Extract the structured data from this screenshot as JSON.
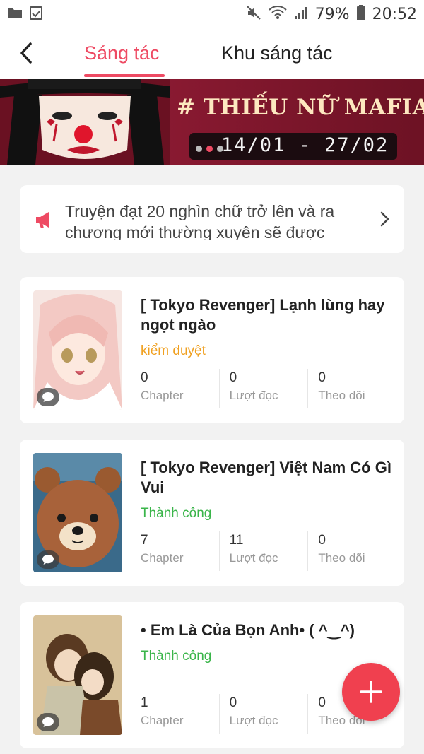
{
  "status_bar": {
    "battery": "79%",
    "time": "20:52"
  },
  "nav": {
    "tabs": [
      {
        "label": "Sáng tác",
        "active": true
      },
      {
        "label": "Khu sáng tác",
        "active": false
      }
    ]
  },
  "banner": {
    "title": "# THIẾU NỮ MAFIA",
    "date": "14/01 - 27/02",
    "slides": 3,
    "active_slide": 2
  },
  "notice": {
    "text": "Truyện đạt 20 nghìn chữ trở lên và ra chương mới thường xuyên sẽ được"
  },
  "stories": [
    {
      "title": "[ Tokyo Revenger] Lạnh lùng hay ngọt ngào",
      "status": "kiểm duyệt",
      "status_color": "#f0a020",
      "stats": [
        {
          "value": "0",
          "label": "Chapter"
        },
        {
          "value": "0",
          "label": "Lượt đọc"
        },
        {
          "value": "0",
          "label": "Theo dõi"
        }
      ]
    },
    {
      "title": "[ Tokyo Revenger] Việt Nam Có Gì Vui",
      "status": "Thành công",
      "status_color": "#3ab54a",
      "stats": [
        {
          "value": "7",
          "label": "Chapter"
        },
        {
          "value": "11",
          "label": "Lượt đọc"
        },
        {
          "value": "0",
          "label": "Theo dõi"
        }
      ]
    },
    {
      "title": "• Em Là Của Bọn Anh• ( ^‿^)",
      "status": "Thành công",
      "status_color": "#3ab54a",
      "stats": [
        {
          "value": "1",
          "label": "Chapter"
        },
        {
          "value": "0",
          "label": "Lượt đọc"
        },
        {
          "value": "0",
          "label": "Theo dõi"
        }
      ]
    }
  ],
  "colors": {
    "accent": "#ee4a63",
    "fab": "#f0404f"
  },
  "icons": {
    "back": "chevron-left-icon",
    "notice": "megaphone-icon",
    "notice_arrow": "chevron-right-icon",
    "fab": "plus-icon",
    "chat": "chat-bubble-icon"
  }
}
